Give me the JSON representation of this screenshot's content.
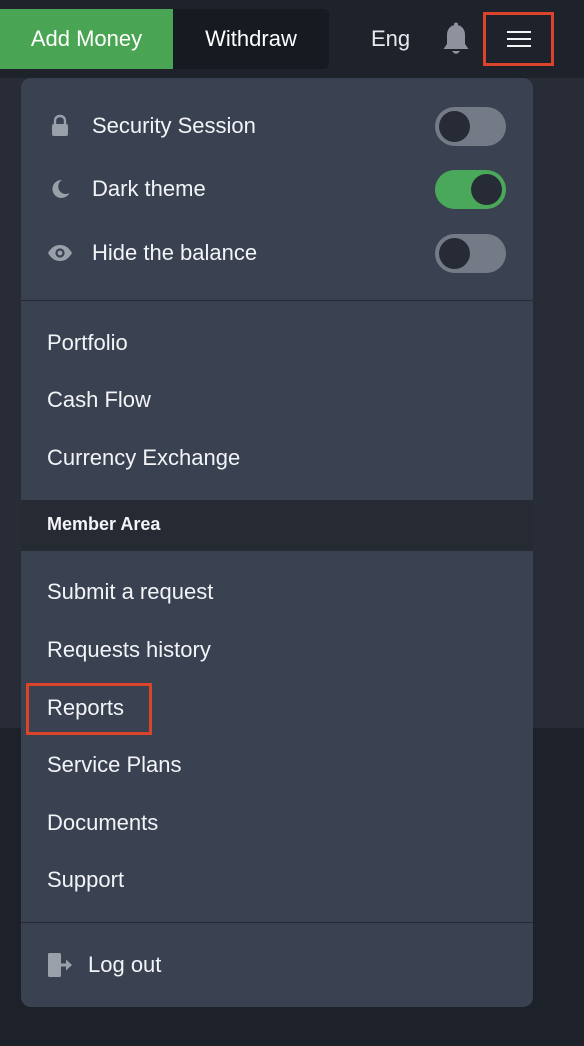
{
  "header": {
    "add_money_label": "Add Money",
    "withdraw_label": "Withdraw",
    "language": "Eng"
  },
  "settings": [
    {
      "label": "Security Session",
      "icon": "lock-icon",
      "enabled": false
    },
    {
      "label": "Dark theme",
      "icon": "moon-icon",
      "enabled": true
    },
    {
      "label": "Hide the balance",
      "icon": "eye-icon",
      "enabled": false
    }
  ],
  "nav": {
    "items": [
      "Portfolio",
      "Cash Flow",
      "Currency Exchange"
    ]
  },
  "member_area": {
    "title": "Member Area",
    "items": [
      "Submit a request",
      "Requests history",
      "Reports",
      "Service Plans",
      "Documents",
      "Support"
    ]
  },
  "logout_label": "Log out",
  "colors": {
    "accent_green": "#49a553",
    "highlight_red": "#d9442b",
    "menu_bg": "#3a4150"
  }
}
